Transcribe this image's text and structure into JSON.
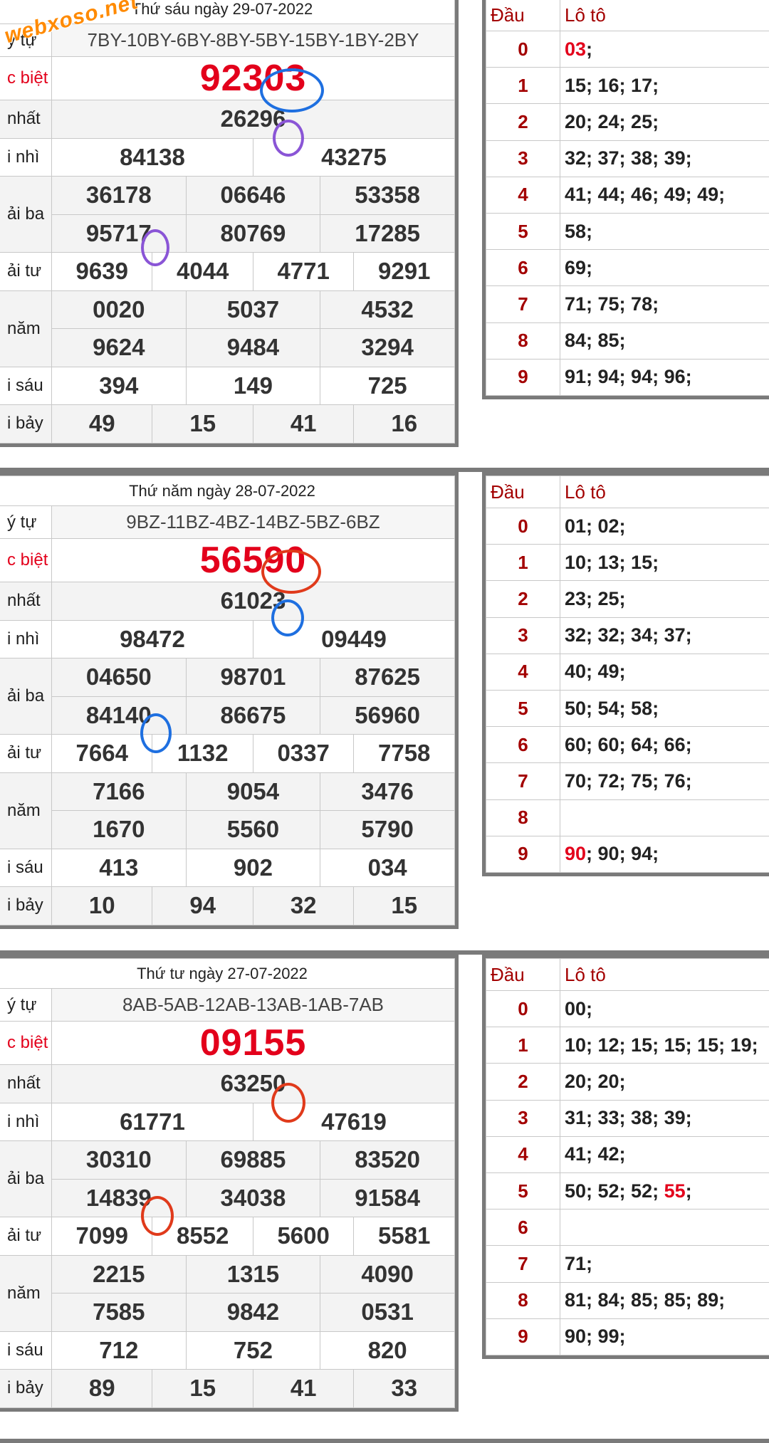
{
  "watermark": "webxoso.net",
  "results": [
    {
      "date": "Thứ sáu ngày 29-07-2022",
      "labels": {
        "code": "ý tự",
        "db": "c biệt",
        "g1": "nhất",
        "g2": "i nhì",
        "g3": "ải ba",
        "g4": "ải tư",
        "g5": "năm",
        "g6": "i sáu",
        "g7": "i bảy"
      },
      "code": "7BY-10BY-6BY-8BY-5BY-15BY-1BY-2BY",
      "db": "92303",
      "g1": "26296",
      "g2": [
        "84138",
        "43275"
      ],
      "g3": [
        "36178",
        "06646",
        "53358",
        "95717",
        "80769",
        "17285"
      ],
      "g4": [
        "9639",
        "4044",
        "4771",
        "9291"
      ],
      "g5": [
        "0020",
        "5037",
        "4532",
        "9624",
        "9484",
        "3294"
      ],
      "g6": [
        "394",
        "149",
        "725"
      ],
      "g7": [
        "49",
        "15",
        "41",
        "16"
      ],
      "loto_header": {
        "dau": "Đầu",
        "loto": "Lô tô"
      },
      "loto": [
        {
          "dau": "0",
          "hl": "03",
          "rest": ";"
        },
        {
          "dau": "1",
          "hl": "",
          "rest": "15; 16; 17;"
        },
        {
          "dau": "2",
          "hl": "",
          "rest": "20; 24; 25;"
        },
        {
          "dau": "3",
          "hl": "",
          "rest": "32; 37; 38; 39;"
        },
        {
          "dau": "4",
          "hl": "",
          "rest": "41; 44; 46; 49; 49;"
        },
        {
          "dau": "5",
          "hl": "",
          "rest": "58;"
        },
        {
          "dau": "6",
          "hl": "",
          "rest": "69;"
        },
        {
          "dau": "7",
          "hl": "",
          "rest": "71; 75; 78;"
        },
        {
          "dau": "8",
          "hl": "",
          "rest": "84; 85;"
        },
        {
          "dau": "9",
          "hl": "",
          "rest": "91; 94; 94; 96;"
        }
      ]
    },
    {
      "date": "Thứ năm ngày 28-07-2022",
      "labels": {
        "code": "ý tự",
        "db": "c biệt",
        "g1": "nhất",
        "g2": "i nhì",
        "g3": "ải ba",
        "g4": "ải tư",
        "g5": "năm",
        "g6": "i sáu",
        "g7": "i bảy"
      },
      "code": "9BZ-11BZ-4BZ-14BZ-5BZ-6BZ",
      "db": "56590",
      "g1": "61023",
      "g2": [
        "98472",
        "09449"
      ],
      "g3": [
        "04650",
        "98701",
        "87625",
        "84140",
        "86675",
        "56960"
      ],
      "g4": [
        "7664",
        "1132",
        "0337",
        "7758"
      ],
      "g5": [
        "7166",
        "9054",
        "3476",
        "1670",
        "5560",
        "5790"
      ],
      "g6": [
        "413",
        "902",
        "034"
      ],
      "g7": [
        "10",
        "94",
        "32",
        "15"
      ],
      "loto_header": {
        "dau": "Đầu",
        "loto": "Lô tô"
      },
      "loto": [
        {
          "dau": "0",
          "hl": "",
          "rest": "01; 02;"
        },
        {
          "dau": "1",
          "hl": "",
          "rest": "10; 13; 15;"
        },
        {
          "dau": "2",
          "hl": "",
          "rest": "23; 25;"
        },
        {
          "dau": "3",
          "hl": "",
          "rest": "32; 32; 34; 37;"
        },
        {
          "dau": "4",
          "hl": "",
          "rest": "40; 49;"
        },
        {
          "dau": "5",
          "hl": "",
          "rest": "50; 54; 58;"
        },
        {
          "dau": "6",
          "hl": "",
          "rest": "60; 60; 64; 66;"
        },
        {
          "dau": "7",
          "hl": "",
          "rest": "70; 72; 75; 76;"
        },
        {
          "dau": "8",
          "hl": "",
          "rest": ""
        },
        {
          "dau": "9",
          "hl": "90",
          "rest": "; 90; 94;"
        }
      ]
    },
    {
      "date": "Thứ tư ngày 27-07-2022",
      "labels": {
        "code": "ý tự",
        "db": "c biệt",
        "g1": "nhất",
        "g2": "i nhì",
        "g3": "ải ba",
        "g4": "ải tư",
        "g5": "năm",
        "g6": "i sáu",
        "g7": "i bảy"
      },
      "code": "8AB-5AB-12AB-13AB-1AB-7AB",
      "db": "09155",
      "g1": "63250",
      "g2": [
        "61771",
        "47619"
      ],
      "g3": [
        "30310",
        "69885",
        "83520",
        "14839",
        "34038",
        "91584"
      ],
      "g4": [
        "7099",
        "8552",
        "5600",
        "5581"
      ],
      "g5": [
        "2215",
        "1315",
        "4090",
        "7585",
        "9842",
        "0531"
      ],
      "g6": [
        "712",
        "752",
        "820"
      ],
      "g7": [
        "89",
        "15",
        "41",
        "33"
      ],
      "loto_header": {
        "dau": "Đầu",
        "loto": "Lô tô"
      },
      "loto": [
        {
          "dau": "0",
          "hl": "",
          "rest": "00;"
        },
        {
          "dau": "1",
          "hl": "",
          "rest": "10; 12; 15; 15; 15; 19;"
        },
        {
          "dau": "2",
          "hl": "",
          "rest": "20; 20;"
        },
        {
          "dau": "3",
          "hl": "",
          "rest": "31; 33; 38; 39;"
        },
        {
          "dau": "4",
          "hl": "",
          "rest": "41; 42;"
        },
        {
          "dau": "5",
          "hl": "",
          "rest": "50; 52; 52; ",
          "hl2": "55",
          "rest2": ";"
        },
        {
          "dau": "6",
          "hl": "",
          "rest": ""
        },
        {
          "dau": "7",
          "hl": "",
          "rest": "71;"
        },
        {
          "dau": "8",
          "hl": "",
          "rest": "81; 84; 85; 85; 89;"
        },
        {
          "dau": "9",
          "hl": "",
          "rest": "90; 99;"
        }
      ]
    }
  ]
}
